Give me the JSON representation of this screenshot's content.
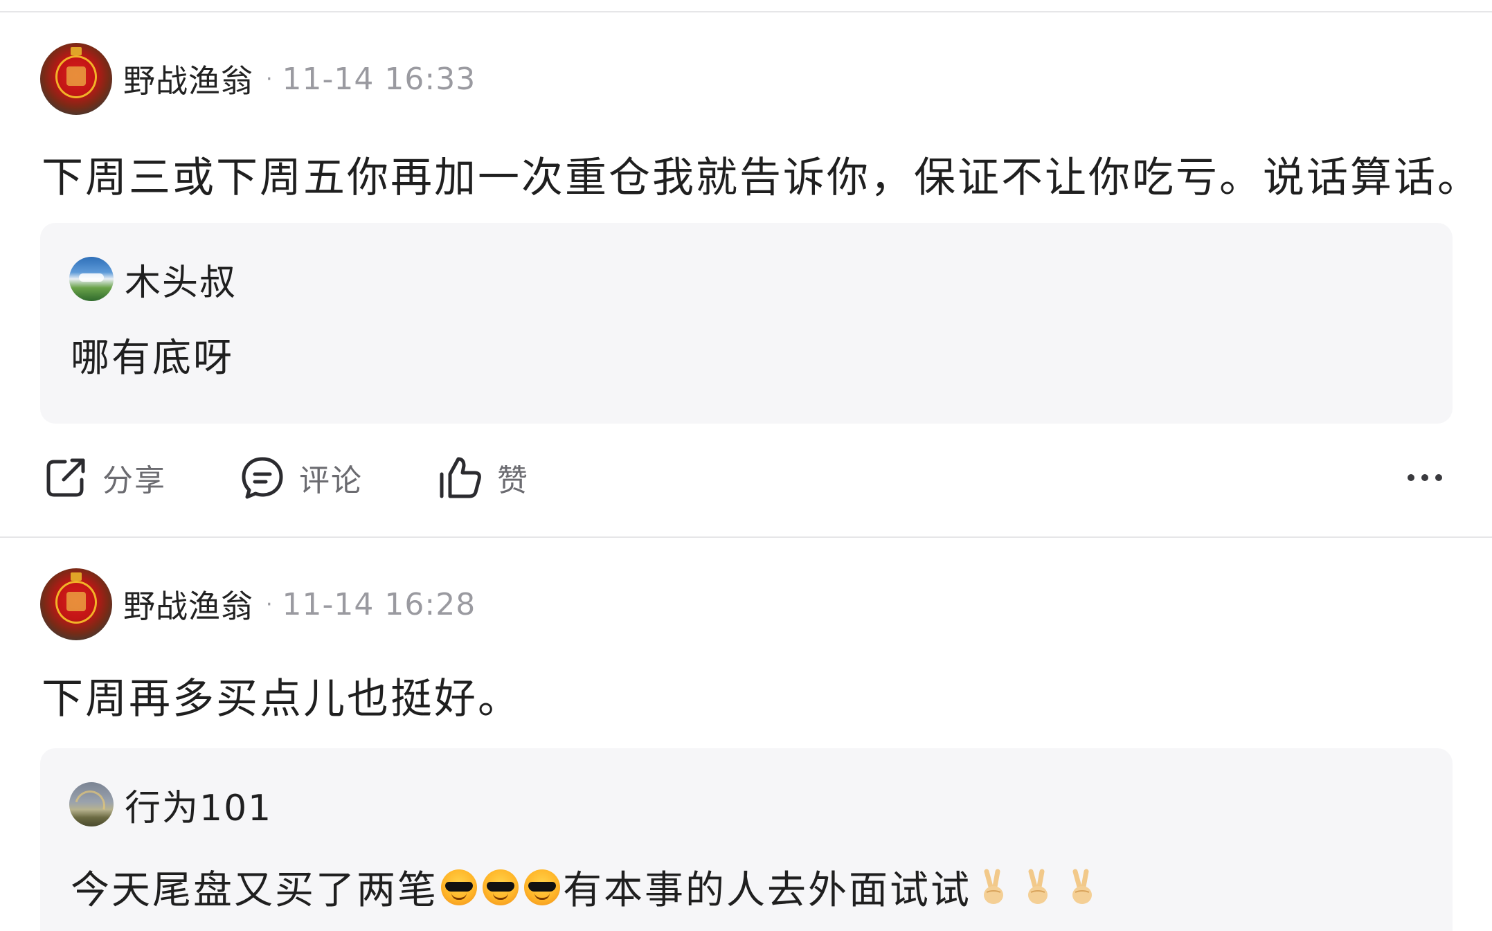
{
  "posts": [
    {
      "author": "野战渔翁",
      "separator": "·",
      "time": "11-14 16:33",
      "text": "下周三或下周五你再加一次重仓我就告诉你，保证不让你吃亏。说话算话。",
      "quote": {
        "author": "木头叔",
        "text": "哪有底呀"
      },
      "actions": {
        "share_label": "分享",
        "comment_label": "评论",
        "like_label": "赞"
      }
    },
    {
      "author": "野战渔翁",
      "separator": "·",
      "time": "11-14 16:28",
      "text": "下周再多买点儿也挺好。",
      "quote": {
        "author": "行为101",
        "text_before": "今天尾盘又买了两笔",
        "text_after": "有本事的人去外面试试",
        "emojis": [
          "sunglasses-face-emoji",
          "sunglasses-face-emoji",
          "sunglasses-face-emoji"
        ],
        "trailing_emojis": [
          "victory-hand-emoji",
          "victory-hand-emoji",
          "victory-hand-emoji"
        ]
      }
    }
  ],
  "colors": {
    "background": "#ffffff",
    "quote_background": "#f6f6f8",
    "meta_text": "#9a9aa0",
    "action_text": "#6b6b70",
    "divider": "#e6e6e8"
  }
}
